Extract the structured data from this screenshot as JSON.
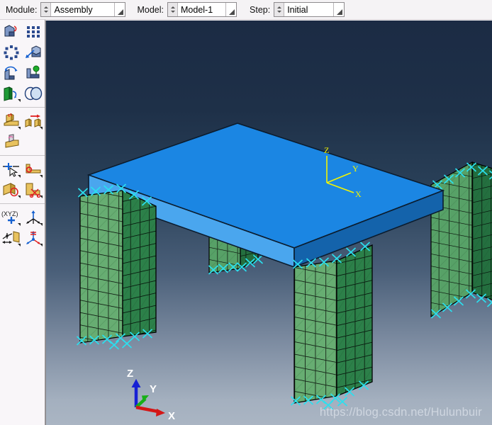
{
  "context_bar": {
    "module": {
      "label": "Module:",
      "value": "Assembly"
    },
    "model": {
      "label": "Model:",
      "value": "Model-1"
    },
    "step": {
      "label": "Step:",
      "value": "Initial"
    }
  },
  "toolbox": {
    "groups": [
      {
        "name": "instance-tools",
        "items": [
          {
            "name": "create-instance-icon",
            "tooltip": "Create Instance"
          },
          {
            "name": "linear-pattern-icon",
            "tooltip": "Linear Pattern"
          },
          {
            "name": "radial-pattern-icon",
            "tooltip": "Radial Pattern"
          },
          {
            "name": "translate-instance-icon",
            "tooltip": "Translate Instance"
          },
          {
            "name": "rotate-instance-icon",
            "tooltip": "Rotate Instance"
          },
          {
            "name": "translate-to-icon",
            "tooltip": "Translate To"
          },
          {
            "name": "instance-from-part-icon",
            "tooltip": "Create Instance From Part"
          },
          {
            "name": "merge-cut-instances-icon",
            "tooltip": "Merge/Cut Instances"
          }
        ]
      },
      {
        "name": "constraint-tools",
        "items": [
          {
            "name": "parallel-face-constraint-icon",
            "tooltip": "Parallel Face"
          },
          {
            "name": "face-to-face-constraint-icon",
            "tooltip": "Face to Face"
          },
          {
            "name": "coaxial-constraint-icon",
            "tooltip": "Coaxial"
          }
        ]
      },
      {
        "name": "query-set-tools",
        "items": [
          {
            "name": "query-information-icon",
            "tooltip": "Query Information"
          },
          {
            "name": "create-set-icon",
            "tooltip": "Create Set"
          },
          {
            "name": "create-surface-icon",
            "tooltip": "Create Surface"
          },
          {
            "name": "partition-cell-icon",
            "tooltip": "Partition Cell"
          }
        ]
      },
      {
        "name": "datum-tools",
        "items": [
          {
            "name": "datum-point-icon",
            "tooltip": "Create Datum Point"
          },
          {
            "name": "datum-axis-icon",
            "tooltip": "Create Datum Axis"
          },
          {
            "name": "datum-plane-icon",
            "tooltip": "Create Datum Plane"
          },
          {
            "name": "datum-csys-icon",
            "tooltip": "Create Datum CSYS"
          }
        ]
      }
    ]
  },
  "viewport": {
    "model_triad": {
      "name": "model-coordinate-triad",
      "color": "#f5f500",
      "x_label": "X",
      "y_label": "Y",
      "z_label": "Z"
    },
    "view_triad": {
      "name": "view-orientation-triad",
      "x_label": "X",
      "y_label": "Y",
      "z_label": "Z",
      "x_color": "#d41616",
      "y_color": "#17b017",
      "z_color": "#1720d4",
      "label_color": "#ffffff"
    },
    "geometry": {
      "table_top": {
        "name": "table-top-plate",
        "meshed": false,
        "top_color": "#1b86e3",
        "front_color": "#4aa6ee",
        "right_color": "#1463ab"
      },
      "legs": [
        {
          "name": "table-leg-front-left",
          "meshed": true
        },
        {
          "name": "table-leg-back-middle",
          "meshed": true
        },
        {
          "name": "table-leg-front-right",
          "meshed": true
        },
        {
          "name": "table-leg-back-right",
          "meshed": true
        }
      ],
      "mesh_color_light": "#5fa86a",
      "mesh_color_mid": "#3c8f51",
      "mesh_color_dark": "#237a42",
      "mesh_edge_color": "#000000",
      "bc_marker_color": "#2ae0ef",
      "bc_marker_name": "encastre-boundary-condition-marker"
    },
    "background": {
      "top_color": "#1b2b44",
      "bottom_color": "#aab5c3"
    },
    "watermark": "https://blog.csdn.net/Hulunbuir"
  }
}
